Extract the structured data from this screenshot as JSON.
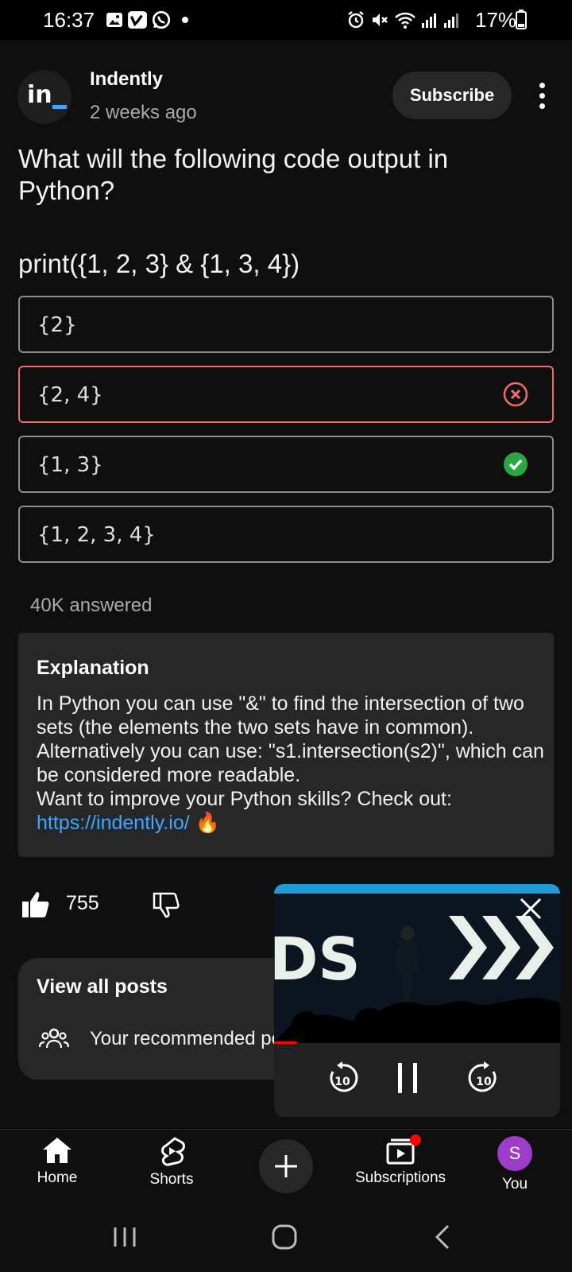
{
  "status_bar": {
    "time": "16:37",
    "battery_percent": "17%"
  },
  "channel": {
    "avatar_text": "in",
    "name": "Indently",
    "posted": "2 weeks ago",
    "subscribe_label": "Subscribe"
  },
  "post": {
    "question": "What will the following code output in Python?",
    "code": "print({1, 2, 3} & {1, 3, 4})",
    "options": [
      {
        "label": "{2}",
        "state": "neutral"
      },
      {
        "label": "{2, 4}",
        "state": "wrong"
      },
      {
        "label": "{1, 3}",
        "state": "correct"
      },
      {
        "label": "{1, 2, 3, 4}",
        "state": "neutral"
      }
    ],
    "answered": "40K answered",
    "explanation": {
      "title": "Explanation",
      "line1": "In Python you can use \"&\" to find the intersection of two sets (the elements the two sets have in common).",
      "line2": "Alternatively you can use: \"s1.intersection(s2)\", which can be considered more readable.",
      "line3": "Want to improve your Python skills? Check out:",
      "link": "https://indently.io/",
      "emoji": "🔥"
    }
  },
  "actions": {
    "likes": "755"
  },
  "posts_card": {
    "title": "View all posts",
    "recommended": "Your recommended po"
  },
  "mini_player": {
    "video_text": "DS",
    "rewind_seconds": "10",
    "forward_seconds": "10",
    "progress_fraction": 0.08
  },
  "bottom_nav": {
    "home": "Home",
    "shorts": "Shorts",
    "subscriptions": "Subscriptions",
    "you": "You",
    "you_initial": "S"
  },
  "colors": {
    "background": "#0f0f0f",
    "card": "#272727",
    "link": "#3ea6ff",
    "wrong": "#f26a6a",
    "correct": "#2ba640",
    "accent_red": "#ff0000",
    "you_avatar": "#9c3cc7"
  }
}
